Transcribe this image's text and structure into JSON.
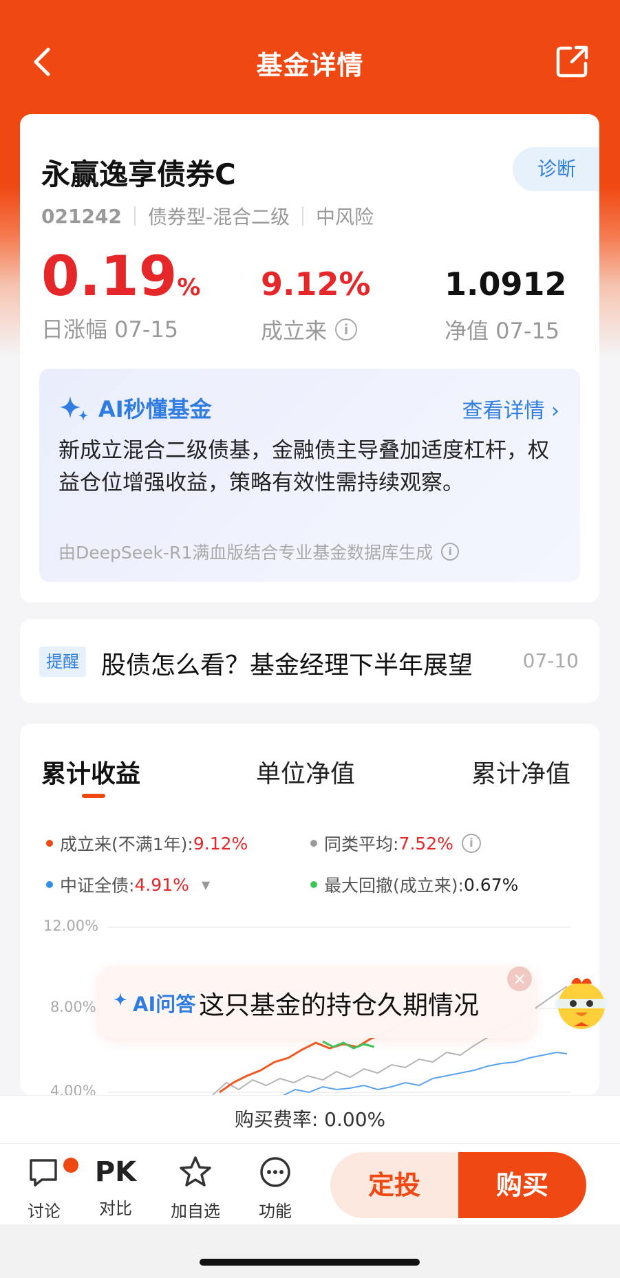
{
  "header": {
    "title": "基金详情"
  },
  "fund": {
    "name": "永赢逸享债券C",
    "diagnose_label": "诊断",
    "code": "021242",
    "type": "债券型-混合二级",
    "risk": "中风险",
    "daily_change": "0.19",
    "daily_change_unit": "%",
    "daily_change_label": "日涨幅 07-15",
    "since_inception": "9.12%",
    "since_inception_label": "成立来",
    "nav": "1.0912",
    "nav_label": "净值 07-15"
  },
  "ai_summary": {
    "title": "AI秒懂基金",
    "more": "查看详情",
    "text": "新成立混合二级债基，金融债主导叠加适度杠杆，权益仓位增强收益，策略有效性需持续观察。",
    "source": "由DeepSeek-R1满血版结合专业基金数据库生成"
  },
  "notice": {
    "tag": "提醒",
    "text": "股债怎么看？基金经理下半年展望",
    "date": "07-10"
  },
  "chart": {
    "tabs": [
      "累计收益",
      "单位净值",
      "累计净值"
    ],
    "legend": [
      {
        "label": "成立来(不满1年):",
        "value": "9.12%",
        "color": "#f04812"
      },
      {
        "label": "同类平均:",
        "value": "7.52%",
        "color": "#999999"
      },
      {
        "label": "中证全债:",
        "value": "4.91%",
        "color": "#2f8fe8"
      },
      {
        "label": "最大回撤(成立来):",
        "value": "0.67%",
        "color": "#3ec65b"
      }
    ],
    "y_ticks": [
      "12.00%",
      "8.00%",
      "4.00%"
    ]
  },
  "ai_float": {
    "prefix": "AI问答",
    "question": "这只基金的持仓久期情况"
  },
  "fee": "购买费率: 0.00%",
  "bottom": {
    "items": [
      {
        "label": "讨论"
      },
      {
        "icon_text": "PK",
        "label": "对比"
      },
      {
        "label": "加自选"
      },
      {
        "label": "功能"
      }
    ],
    "regular_invest": "定投",
    "buy": "购买"
  },
  "colors": {
    "brand": "#f04812",
    "up": "#e5272a",
    "link": "#2f7de1"
  }
}
